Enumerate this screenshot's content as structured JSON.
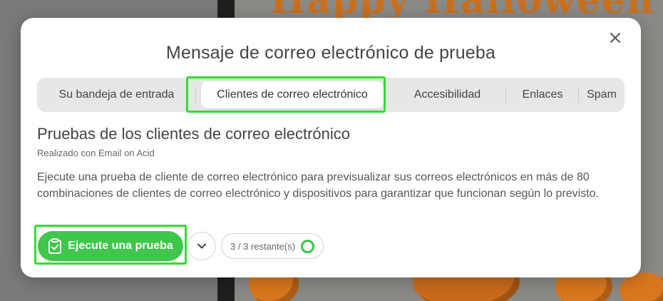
{
  "background": {
    "banner_text": "Happy Halloween"
  },
  "modal": {
    "title": "Mensaje de correo electrónico de prueba",
    "close_icon": "close-icon",
    "tabs": [
      {
        "label": "Su bandeja de entrada",
        "active": false
      },
      {
        "label": "Clientes de correo electrónico",
        "active": true
      },
      {
        "label": "Accesibilidad",
        "active": false
      },
      {
        "label": "Enlaces",
        "active": false
      },
      {
        "label": "Spam",
        "active": false
      }
    ],
    "section": {
      "title": "Pruebas de los clientes de correo electrónico",
      "powered_by": "Realizado con Email on Acid",
      "description": "Ejecute una prueba de cliente de correo electrónico para previsualizar sus correos electrónicos en más de 80 combinaciones de clientes de correo electrónico y dispositivos para garantizar que funcionan según lo previsto."
    },
    "actions": {
      "run_label": "Ejecute una prueba",
      "run_icon": "clipboard-check-icon",
      "dropdown_icon": "chevron-down-icon",
      "quota_text": "3 / 3 restante(s)"
    }
  },
  "colors": {
    "accent_green": "#3ec74b",
    "highlight_green": "#2ee02e"
  }
}
